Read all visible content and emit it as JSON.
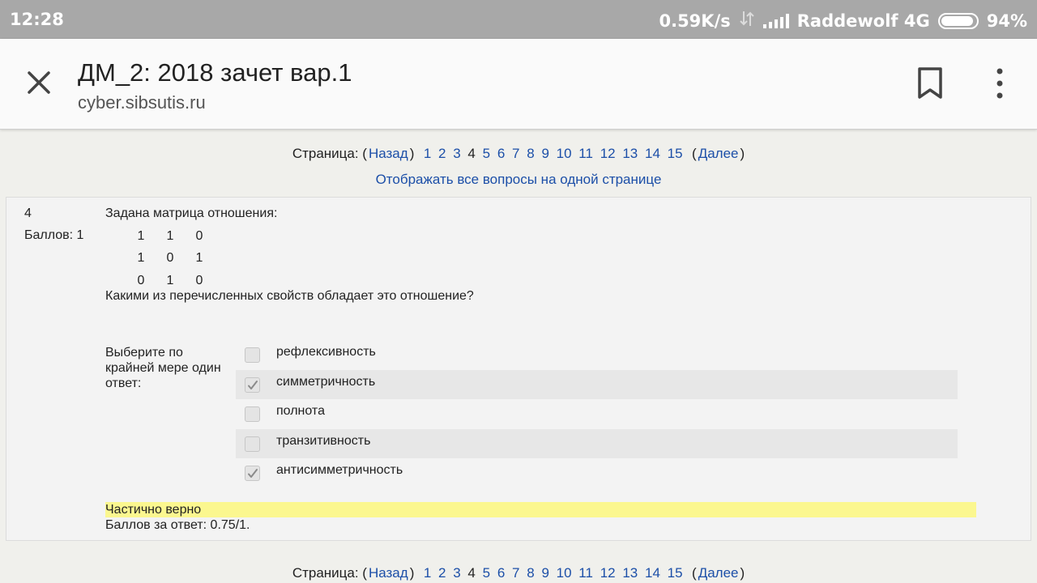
{
  "status": {
    "time": "12:28",
    "speed": "0.59K/s",
    "carrier": "Raddewolf 4G",
    "battery": "94%"
  },
  "toolbar": {
    "title": "ДМ_2: 2018 зачет вар.1",
    "url": "cyber.sibsutis.ru",
    "icons": [
      "close-icon",
      "bookmark-icon",
      "more-vert-icon"
    ]
  },
  "pager": {
    "label": "Страница: (",
    "prev": "Назад",
    "paren_close": ")",
    "pages": [
      "1",
      "2",
      "3",
      "4",
      "5",
      "6",
      "7",
      "8",
      "9",
      "10",
      "11",
      "12",
      "13",
      "14",
      "15"
    ],
    "current": "4",
    "paren_open": "(",
    "next": "Далее",
    "end": ")"
  },
  "show_all": "Отображать все вопросы на одной странице",
  "question": {
    "number": "4",
    "score": "Баллов: 1",
    "text": "Задана матрица отношения:",
    "matrix": [
      [
        "1",
        "1",
        "0"
      ],
      [
        "1",
        "0",
        "1"
      ],
      [
        "0",
        "1",
        "0"
      ]
    ],
    "ask": "Какими из перечисленных свойств обладает это отношение?",
    "prompt": "Выберите по крайней мере один ответ:",
    "answers": [
      {
        "label": "рефлексивность",
        "checked": false
      },
      {
        "label": "симметричность",
        "checked": true
      },
      {
        "label": "полнота",
        "checked": false
      },
      {
        "label": "транзитивность",
        "checked": false
      },
      {
        "label": "антисимметричность",
        "checked": true
      }
    ],
    "feedback": "Частично верно",
    "points": "Баллов за ответ: 0.75/1."
  },
  "colors": {
    "link": "#1c4fa8",
    "feedback_bg": "#fbf78f",
    "statusbar": "#a8a8a8"
  }
}
